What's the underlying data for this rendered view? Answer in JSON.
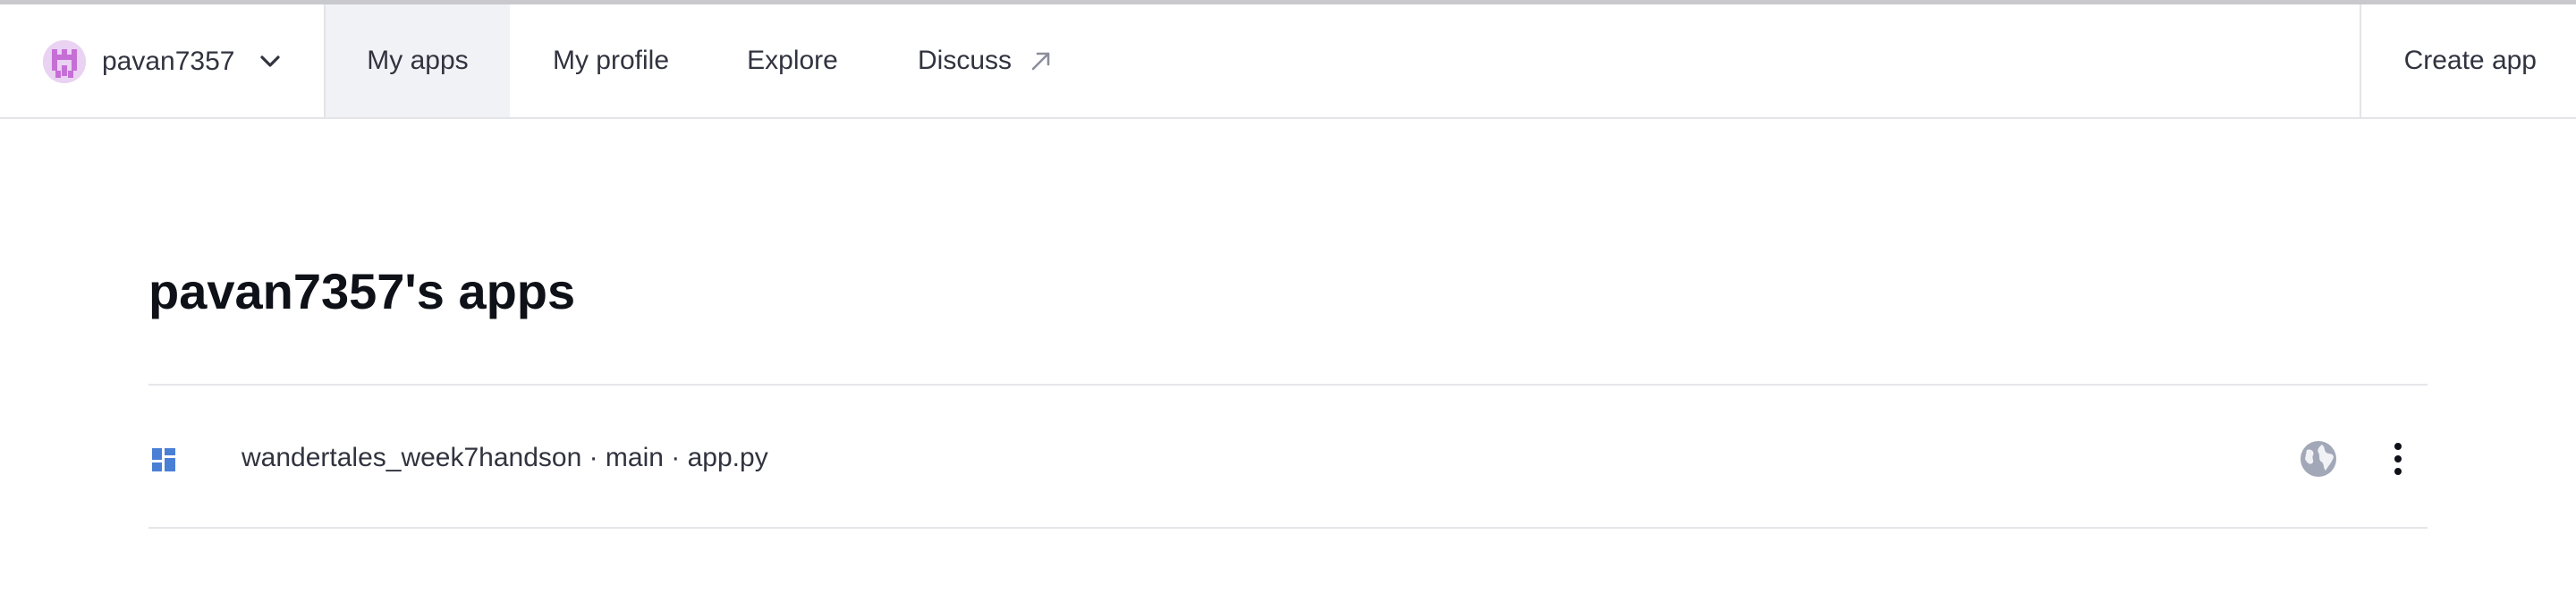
{
  "nav": {
    "username": "pavan7357",
    "tabs": [
      {
        "label": "My apps",
        "active": true
      },
      {
        "label": "My profile",
        "active": false
      },
      {
        "label": "Explore",
        "active": false
      },
      {
        "label": "Discuss",
        "active": false,
        "external": true
      }
    ],
    "create_app_label": "Create app"
  },
  "main": {
    "title": "pavan7357's apps",
    "apps": [
      {
        "name": "wandertales_week7handson · main · app.py",
        "icon": "app-grid-icon",
        "visibility_icon": "globe-icon",
        "menu_icon": "more-vertical-icon"
      }
    ]
  },
  "colors": {
    "active_tab_bg": "#f0f2f6",
    "app_icon": "#4a7fd6",
    "globe_icon": "#a3a8b8",
    "avatar_bg": "#ead2f2",
    "avatar_fg": "#c56fd6"
  }
}
